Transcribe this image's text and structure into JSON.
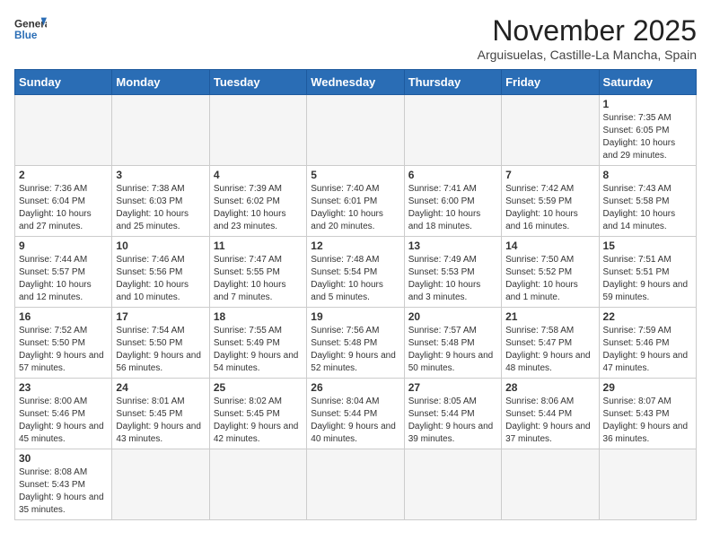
{
  "header": {
    "logo_line1": "General",
    "logo_line2": "Blue",
    "month_title": "November 2025",
    "location": "Arguisuelas, Castille-La Mancha, Spain"
  },
  "weekdays": [
    "Sunday",
    "Monday",
    "Tuesday",
    "Wednesday",
    "Thursday",
    "Friday",
    "Saturday"
  ],
  "weeks": [
    [
      {
        "day": "",
        "info": ""
      },
      {
        "day": "",
        "info": ""
      },
      {
        "day": "",
        "info": ""
      },
      {
        "day": "",
        "info": ""
      },
      {
        "day": "",
        "info": ""
      },
      {
        "day": "",
        "info": ""
      },
      {
        "day": "1",
        "info": "Sunrise: 7:35 AM\nSunset: 6:05 PM\nDaylight: 10 hours\nand 29 minutes."
      }
    ],
    [
      {
        "day": "2",
        "info": "Sunrise: 7:36 AM\nSunset: 6:04 PM\nDaylight: 10 hours\nand 27 minutes."
      },
      {
        "day": "3",
        "info": "Sunrise: 7:38 AM\nSunset: 6:03 PM\nDaylight: 10 hours\nand 25 minutes."
      },
      {
        "day": "4",
        "info": "Sunrise: 7:39 AM\nSunset: 6:02 PM\nDaylight: 10 hours\nand 23 minutes."
      },
      {
        "day": "5",
        "info": "Sunrise: 7:40 AM\nSunset: 6:01 PM\nDaylight: 10 hours\nand 20 minutes."
      },
      {
        "day": "6",
        "info": "Sunrise: 7:41 AM\nSunset: 6:00 PM\nDaylight: 10 hours\nand 18 minutes."
      },
      {
        "day": "7",
        "info": "Sunrise: 7:42 AM\nSunset: 5:59 PM\nDaylight: 10 hours\nand 16 minutes."
      },
      {
        "day": "8",
        "info": "Sunrise: 7:43 AM\nSunset: 5:58 PM\nDaylight: 10 hours\nand 14 minutes."
      }
    ],
    [
      {
        "day": "9",
        "info": "Sunrise: 7:44 AM\nSunset: 5:57 PM\nDaylight: 10 hours\nand 12 minutes."
      },
      {
        "day": "10",
        "info": "Sunrise: 7:46 AM\nSunset: 5:56 PM\nDaylight: 10 hours\nand 10 minutes."
      },
      {
        "day": "11",
        "info": "Sunrise: 7:47 AM\nSunset: 5:55 PM\nDaylight: 10 hours\nand 7 minutes."
      },
      {
        "day": "12",
        "info": "Sunrise: 7:48 AM\nSunset: 5:54 PM\nDaylight: 10 hours\nand 5 minutes."
      },
      {
        "day": "13",
        "info": "Sunrise: 7:49 AM\nSunset: 5:53 PM\nDaylight: 10 hours\nand 3 minutes."
      },
      {
        "day": "14",
        "info": "Sunrise: 7:50 AM\nSunset: 5:52 PM\nDaylight: 10 hours\nand 1 minute."
      },
      {
        "day": "15",
        "info": "Sunrise: 7:51 AM\nSunset: 5:51 PM\nDaylight: 9 hours\nand 59 minutes."
      }
    ],
    [
      {
        "day": "16",
        "info": "Sunrise: 7:52 AM\nSunset: 5:50 PM\nDaylight: 9 hours\nand 57 minutes."
      },
      {
        "day": "17",
        "info": "Sunrise: 7:54 AM\nSunset: 5:50 PM\nDaylight: 9 hours\nand 56 minutes."
      },
      {
        "day": "18",
        "info": "Sunrise: 7:55 AM\nSunset: 5:49 PM\nDaylight: 9 hours\nand 54 minutes."
      },
      {
        "day": "19",
        "info": "Sunrise: 7:56 AM\nSunset: 5:48 PM\nDaylight: 9 hours\nand 52 minutes."
      },
      {
        "day": "20",
        "info": "Sunrise: 7:57 AM\nSunset: 5:48 PM\nDaylight: 9 hours\nand 50 minutes."
      },
      {
        "day": "21",
        "info": "Sunrise: 7:58 AM\nSunset: 5:47 PM\nDaylight: 9 hours\nand 48 minutes."
      },
      {
        "day": "22",
        "info": "Sunrise: 7:59 AM\nSunset: 5:46 PM\nDaylight: 9 hours\nand 47 minutes."
      }
    ],
    [
      {
        "day": "23",
        "info": "Sunrise: 8:00 AM\nSunset: 5:46 PM\nDaylight: 9 hours\nand 45 minutes."
      },
      {
        "day": "24",
        "info": "Sunrise: 8:01 AM\nSunset: 5:45 PM\nDaylight: 9 hours\nand 43 minutes."
      },
      {
        "day": "25",
        "info": "Sunrise: 8:02 AM\nSunset: 5:45 PM\nDaylight: 9 hours\nand 42 minutes."
      },
      {
        "day": "26",
        "info": "Sunrise: 8:04 AM\nSunset: 5:44 PM\nDaylight: 9 hours\nand 40 minutes."
      },
      {
        "day": "27",
        "info": "Sunrise: 8:05 AM\nSunset: 5:44 PM\nDaylight: 9 hours\nand 39 minutes."
      },
      {
        "day": "28",
        "info": "Sunrise: 8:06 AM\nSunset: 5:44 PM\nDaylight: 9 hours\nand 37 minutes."
      },
      {
        "day": "29",
        "info": "Sunrise: 8:07 AM\nSunset: 5:43 PM\nDaylight: 9 hours\nand 36 minutes."
      }
    ],
    [
      {
        "day": "30",
        "info": "Sunrise: 8:08 AM\nSunset: 5:43 PM\nDaylight: 9 hours\nand 35 minutes."
      },
      {
        "day": "",
        "info": ""
      },
      {
        "day": "",
        "info": ""
      },
      {
        "day": "",
        "info": ""
      },
      {
        "day": "",
        "info": ""
      },
      {
        "day": "",
        "info": ""
      },
      {
        "day": "",
        "info": ""
      }
    ]
  ]
}
